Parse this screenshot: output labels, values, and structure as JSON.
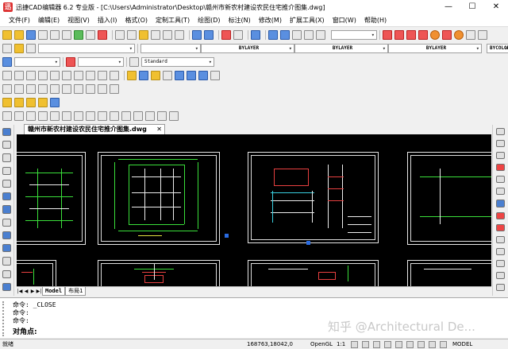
{
  "window": {
    "title": "迅捷CAD编辑器 6.2 专业版 - [C:\\Users\\Administrator\\Desktop\\赣州市新农村建设农民住宅推介图集.dwg]",
    "app_icon_letter": "迅",
    "minimize": "—",
    "maximize": "☐",
    "close": "✕"
  },
  "menu": {
    "items": [
      "文件(F)",
      "编辑(E)",
      "视图(V)",
      "插入(I)",
      "格式(O)",
      "定制工具(T)",
      "绘图(D)",
      "标注(N)",
      "修改(M)",
      "扩展工具(X)",
      "窗口(W)",
      "帮助(H)"
    ]
  },
  "properties_bar": {
    "layer_value": "",
    "color_value": "",
    "linetype_value": "BYLAYER",
    "lineweight_value": "BYLAYER",
    "plotstyle_value": "BYLAYER",
    "bycolor": "BYCOLOR"
  },
  "style_bar": {
    "text_style": "",
    "dim_style": "",
    "standard": "Standard"
  },
  "document": {
    "tab_label": "赣州市新农村建设农民住宅推介图集.dwg",
    "tab_close": "✕"
  },
  "layout_tabs": {
    "model": "Model",
    "layout1": "布局1"
  },
  "command": {
    "history": [
      "命令:  _CLOSE",
      "命令:",
      "命令:"
    ],
    "prompt": "对角点:"
  },
  "watermark": "知乎 @Architectural De...",
  "status": {
    "ready": "就绪",
    "coords": "168763,18042,0",
    "opengl": "OpenGL",
    "scale": "1:1",
    "model": "MODEL"
  },
  "colors": {
    "canvas_bg": "#000000",
    "drawing_green": "#3adf3a",
    "drawing_cyan": "#3ad0e0",
    "drawing_red": "#e84040",
    "sheet_border": "#e8e8e8"
  }
}
